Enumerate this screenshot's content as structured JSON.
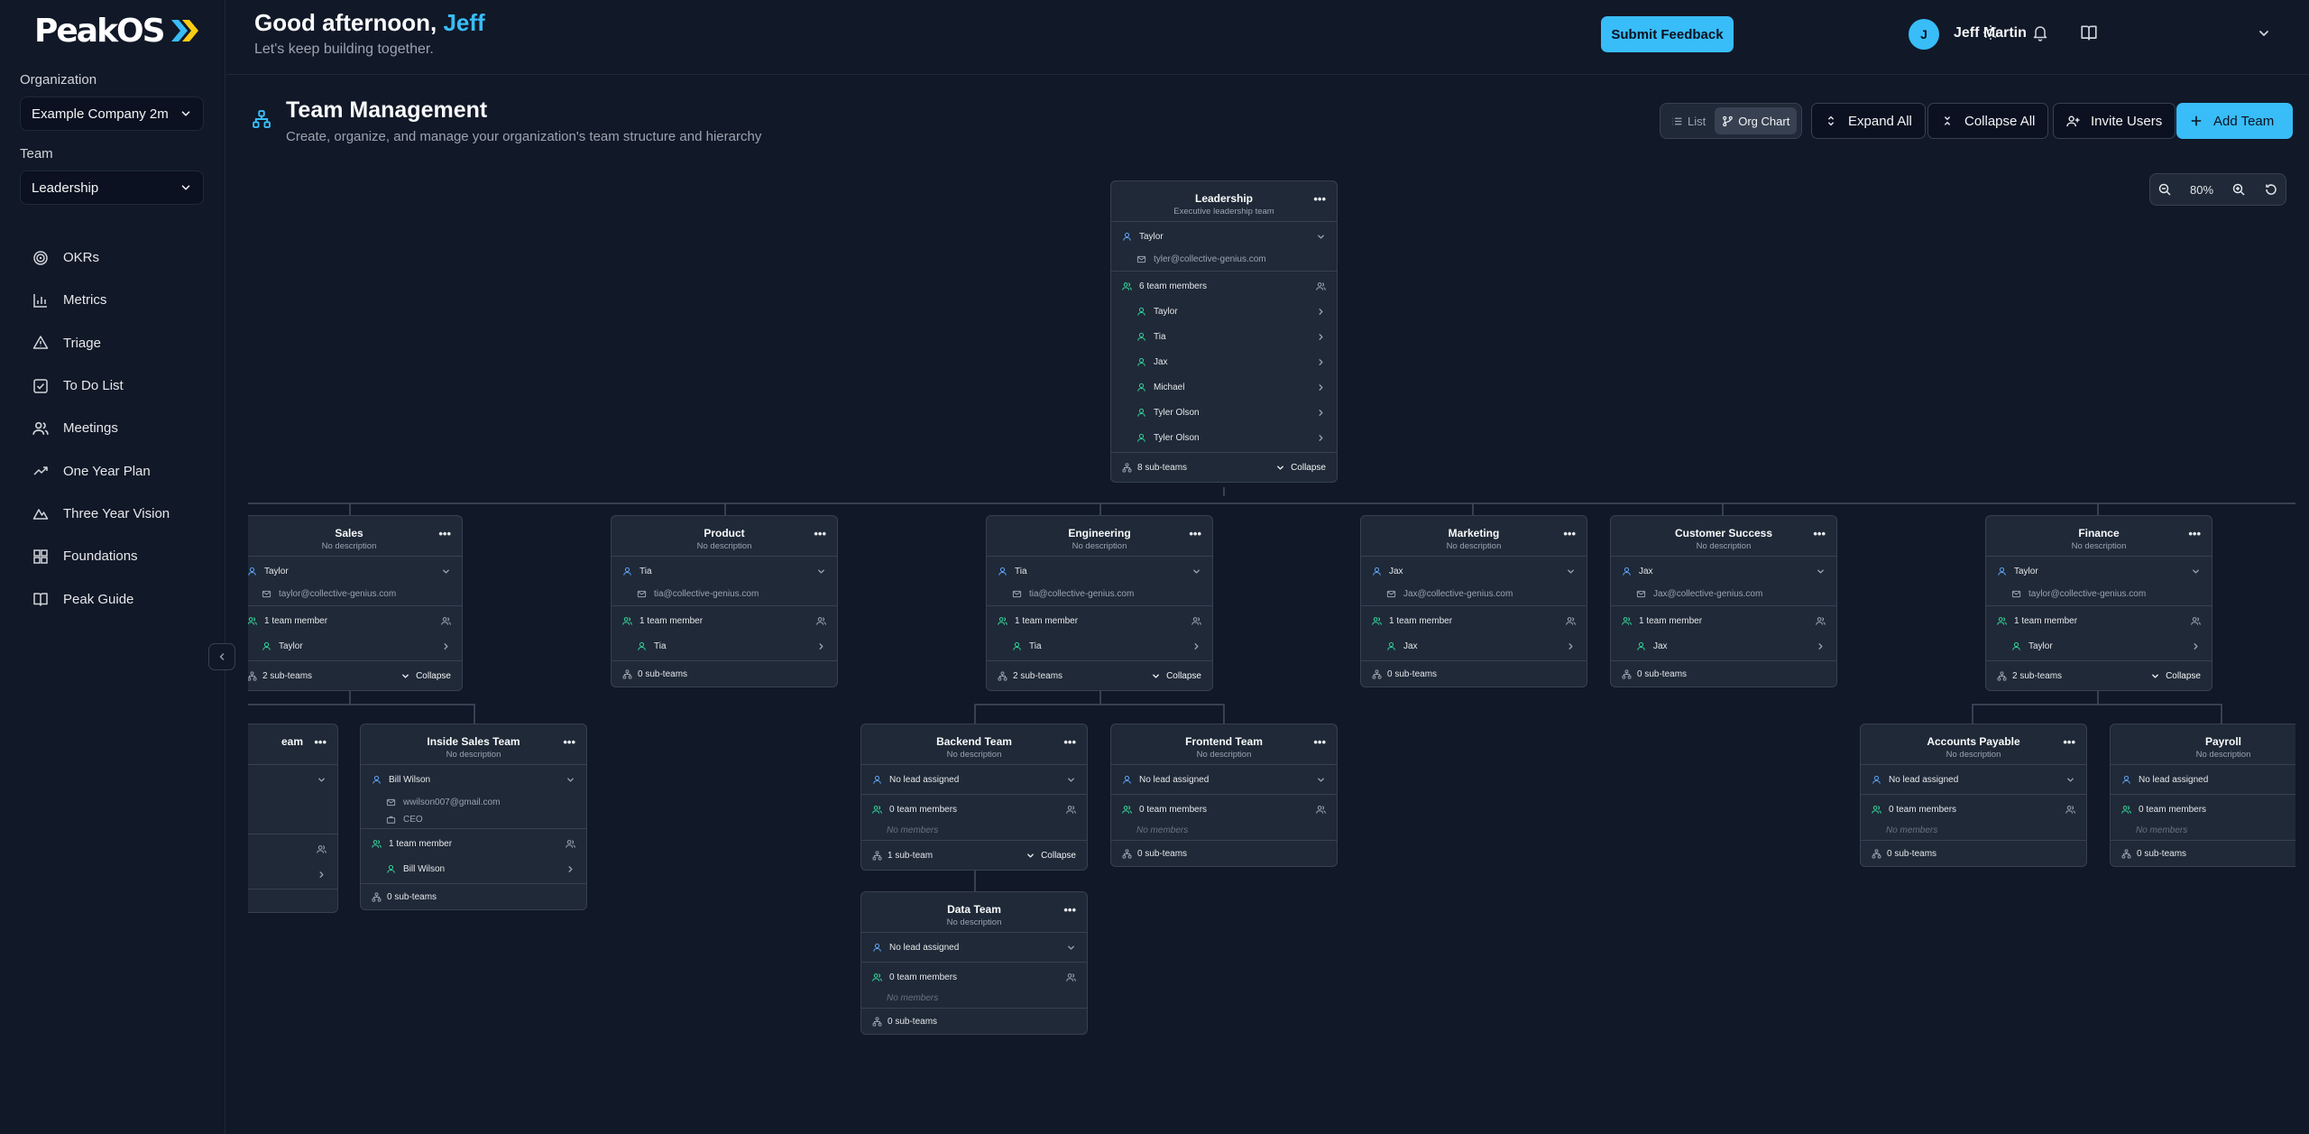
{
  "app": {
    "logo": "PeakOS"
  },
  "sidebar": {
    "org_label": "Organization",
    "org_value": "Example Company 2m",
    "team_label": "Team",
    "team_value": "Leadership",
    "items": [
      {
        "label": "OKRs",
        "icon": "target-icon"
      },
      {
        "label": "Metrics",
        "icon": "bar-chart-icon"
      },
      {
        "label": "Triage",
        "icon": "warning-icon"
      },
      {
        "label": "To Do List",
        "icon": "checkbox-icon"
      },
      {
        "label": "Meetings",
        "icon": "users-icon"
      },
      {
        "label": "One Year Plan",
        "icon": "trending-up-icon"
      },
      {
        "label": "Three Year Vision",
        "icon": "mountain-icon"
      },
      {
        "label": "Foundations",
        "icon": "blocks-icon"
      },
      {
        "label": "Peak Guide",
        "icon": "book-icon"
      }
    ]
  },
  "header": {
    "greeting": "Good afternoon,",
    "greeting_name": "Jeff",
    "subtitle": "Let's keep building together.",
    "feedback": "Submit Feedback",
    "user_initial": "J",
    "user_name": "Jeff Martin"
  },
  "page": {
    "title": "Team Management",
    "subtitle": "Create, organize, and manage your organization's team structure and hierarchy",
    "view_list": "List",
    "view_org": "Org Chart",
    "expand_all": "Expand All",
    "collapse_all": "Collapse All",
    "invite": "Invite Users",
    "add_team": "Add Team",
    "zoom": "80%"
  },
  "org": {
    "leadership": {
      "name": "Leadership",
      "desc": "Executive leadership team",
      "lead": "Taylor",
      "email": "tyler@collective-genius.com",
      "members_label": "6 team members",
      "members": [
        "Taylor",
        "Tia",
        "Jax",
        "Michael",
        "Tyler Olson",
        "Tyler Olson"
      ],
      "subteams": "8 sub-teams",
      "collapse": "Collapse"
    },
    "sales": {
      "name": "Sales",
      "desc": "No description",
      "lead": "Taylor",
      "email": "taylor@collective-genius.com",
      "members_label": "1 team member",
      "members": [
        "Taylor"
      ],
      "subteams": "2 sub-teams",
      "collapse": "Collapse"
    },
    "product": {
      "name": "Product",
      "desc": "No description",
      "lead": "Tia",
      "email": "tia@collective-genius.com",
      "members_label": "1 team member",
      "members": [
        "Tia"
      ],
      "subteams": "0 sub-teams"
    },
    "engineering": {
      "name": "Engineering",
      "desc": "No description",
      "lead": "Tia",
      "email": "tia@collective-genius.com",
      "members_label": "1 team member",
      "members": [
        "Tia"
      ],
      "subteams": "2 sub-teams",
      "collapse": "Collapse"
    },
    "marketing": {
      "name": "Marketing",
      "desc": "No description",
      "lead": "Jax",
      "email": "Jax@collective-genius.com",
      "members_label": "1 team member",
      "members": [
        "Jax"
      ],
      "subteams": "0 sub-teams"
    },
    "customer_success": {
      "name": "Customer Success",
      "desc": "No description",
      "lead": "Jax",
      "email": "Jax@collective-genius.com",
      "members_label": "1 team member",
      "members": [
        "Jax"
      ],
      "subteams": "0 sub-teams"
    },
    "finance": {
      "name": "Finance",
      "desc": "No description",
      "lead": "Taylor",
      "email": "taylor@collective-genius.com",
      "members_label": "1 team member",
      "members": [
        "Taylor"
      ],
      "subteams": "2 sub-teams",
      "collapse": "Collapse"
    },
    "partial_team": {
      "name": "eam"
    },
    "inside_sales": {
      "name": "Inside Sales Team",
      "desc": "No description",
      "lead": "Bill Wilson",
      "email": "wwilson007@gmail.com",
      "role": "CEO",
      "members_label": "1 team member",
      "members": [
        "Bill Wilson"
      ],
      "subteams": "0 sub-teams"
    },
    "backend": {
      "name": "Backend Team",
      "desc": "No description",
      "lead": "No lead assigned",
      "members_label": "0 team members",
      "no_members": "No members",
      "subteams": "1 sub-team",
      "collapse": "Collapse"
    },
    "frontend": {
      "name": "Frontend Team",
      "desc": "No description",
      "lead": "No lead assigned",
      "members_label": "0 team members",
      "no_members": "No members",
      "subteams": "0 sub-teams"
    },
    "data": {
      "name": "Data Team",
      "desc": "No description",
      "lead": "No lead assigned",
      "members_label": "0 team members",
      "no_members": "No members",
      "subteams": "0 sub-teams"
    },
    "accounts_payable": {
      "name": "Accounts Payable",
      "desc": "No description",
      "lead": "No lead assigned",
      "members_label": "0 team members",
      "no_members": "No members",
      "subteams": "0 sub-teams"
    },
    "payroll": {
      "name": "Payroll",
      "desc": "No description",
      "lead": "No lead assigned",
      "members_label": "0 team members",
      "no_members": "No members",
      "subteams": "0 sub-teams"
    }
  },
  "colors": {
    "accent": "#38bdf8",
    "background": "#111827",
    "card": "#1f2937",
    "lead_icon": "#60a5fa",
    "member_icon": "#34d399"
  }
}
